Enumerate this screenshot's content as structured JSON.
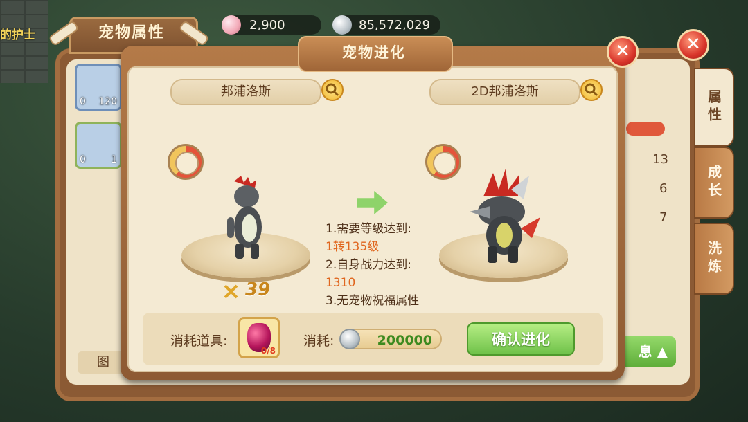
{
  "currency": {
    "pearls": "2,900",
    "silver": "85,572,029"
  },
  "background": {
    "panel_title": "宠物属性",
    "corner_text": "的护士",
    "tabs": [
      "属性",
      "成长",
      "洗炼"
    ],
    "pets": [
      {
        "num": "0",
        "lvl": "120"
      },
      {
        "num": "0",
        "lvl": "1"
      }
    ],
    "stats": [
      "13",
      "6",
      "7"
    ],
    "bottom_left": "图",
    "info_button": "息"
  },
  "dialog": {
    "title": "宠物进化",
    "close": "✕",
    "left_pet": {
      "name": "邦浦洛斯",
      "level": "39"
    },
    "right_pet": {
      "name": "2D邦浦洛斯"
    },
    "requirements": [
      "1.需要等级达到:",
      "1转135级",
      "2.自身战力达到:",
      "1310",
      "3.无宠物祝福属性"
    ],
    "cost": {
      "item_label": "消耗道具:",
      "item_count": "0/8",
      "coin_label": "消耗:",
      "coin_value": "200000"
    },
    "confirm_label": "确认进化"
  },
  "colors": {
    "highlight": "#e0661e",
    "confirm_green": "#6fc24a",
    "coin_text": "#3d8a1f"
  },
  "icons": [
    "pearl-icon",
    "silver-coin-icon",
    "magnifier-icon",
    "medal-icon",
    "arrow-right-icon",
    "red-gem-icon",
    "coin-icon",
    "close-icon"
  ]
}
